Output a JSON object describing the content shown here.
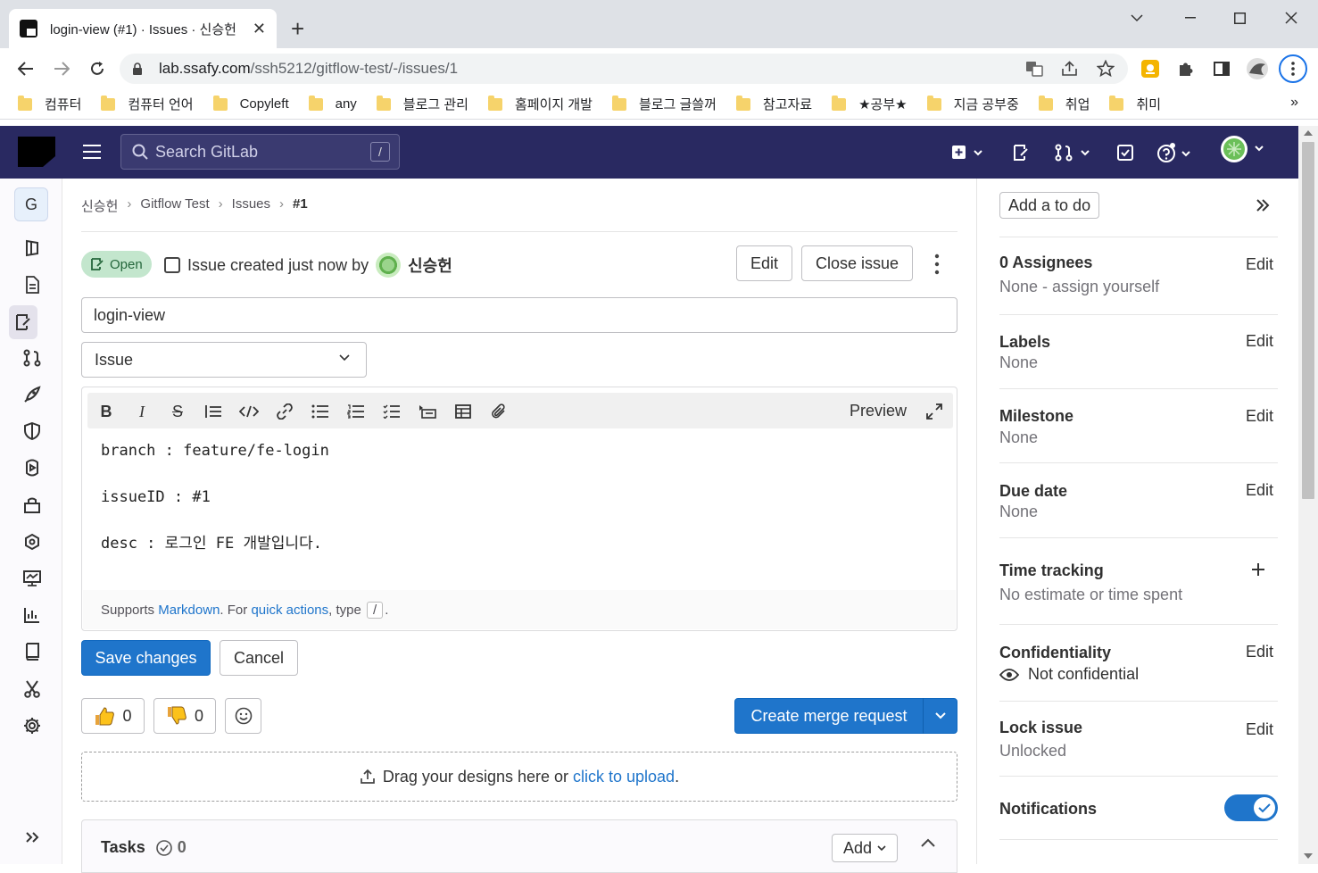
{
  "browser": {
    "tab_title": "login-view (#1) · Issues · 신승헌",
    "url_host": "lab.ssafy.com",
    "url_path": "/ssh5212/gitflow-test/-/issues/1",
    "bookmarks": [
      "컴퓨터",
      "컴퓨터 언어",
      "Copyleft",
      "any",
      "블로그 관리",
      "홈페이지 개발",
      "블로그 글쓸꺼",
      "참고자료",
      "★공부★",
      "지금 공부중",
      "취업",
      "취미"
    ],
    "bookmarks_more": "»"
  },
  "gitlab": {
    "search_placeholder": "Search GitLab",
    "search_shortcut": "/",
    "project_letter": "G"
  },
  "breadcrumb": {
    "items": [
      "신승헌",
      "Gitflow Test",
      "Issues"
    ],
    "current": "#1",
    "separator": "›"
  },
  "issue": {
    "status": "Open",
    "created_text": "Issue created just now by",
    "author": "신승헌",
    "edit_label": "Edit",
    "close_label": "Close issue",
    "title_value": "login-view",
    "type_value": "Issue",
    "preview_label": "Preview",
    "description": "branch : feature/fe-login\n\nissueID : #1\n\ndesc : 로그인 FE 개발입니다.",
    "footer_supports": "Supports ",
    "footer_markdown": "Markdown",
    "footer_for": ". For ",
    "footer_quick_actions": "quick actions",
    "footer_type": ", type ",
    "footer_kbd": "/",
    "footer_end": ".",
    "save_label": "Save changes",
    "cancel_label": "Cancel",
    "thumbs_up_count": "0",
    "thumbs_down_count": "0",
    "create_mr_label": "Create merge request",
    "drop_text": "Drag your designs here or ",
    "drop_link": "click to upload",
    "drop_end": ".",
    "tasks_label": "Tasks",
    "tasks_count": "0",
    "tasks_add": "Add"
  },
  "sidebar": {
    "todo_label": "Add a to do",
    "assignees_title": "0 Assignees",
    "assignees_value": "None - assign yourself",
    "labels_title": "Labels",
    "labels_value": "None",
    "milestone_title": "Milestone",
    "milestone_value": "None",
    "due_title": "Due date",
    "due_value": "None",
    "time_title": "Time tracking",
    "time_value": "No estimate or time spent",
    "conf_title": "Confidentiality",
    "conf_value": "Not confidential",
    "lock_title": "Lock issue",
    "lock_value": "Unlocked",
    "notif_title": "Notifications",
    "edit_label": "Edit",
    "notifications_on": true
  },
  "colors": {
    "header_bg": "#292961",
    "primary": "#1f75cb",
    "open_badge_bg": "#c3e6cd",
    "open_badge_text": "#24663b"
  }
}
